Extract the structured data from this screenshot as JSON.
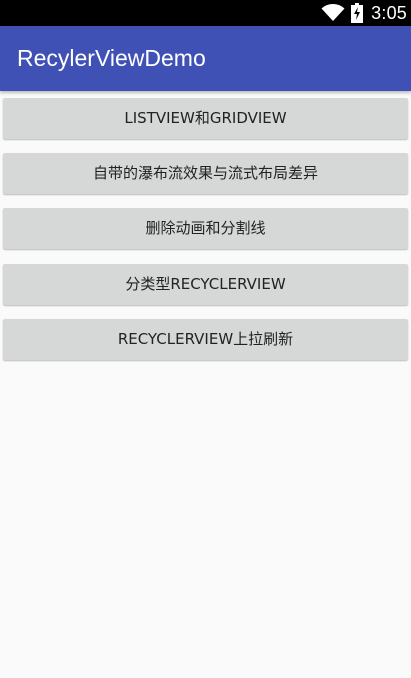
{
  "status_bar": {
    "time": "3:05",
    "icons": [
      "wifi-icon",
      "battery-charging-icon"
    ]
  },
  "app_bar": {
    "title": "RecylerViewDemo",
    "background_color": "#3f51b5"
  },
  "buttons": [
    {
      "label": "LISTVIEW和GRIDVIEW"
    },
    {
      "label": "自带的瀑布流效果与流式布局差异"
    },
    {
      "label": "删除动画和分割线"
    },
    {
      "label": "分类型RECYCLERVIEW"
    },
    {
      "label": "RECYCLERVIEW上拉刷新"
    }
  ]
}
